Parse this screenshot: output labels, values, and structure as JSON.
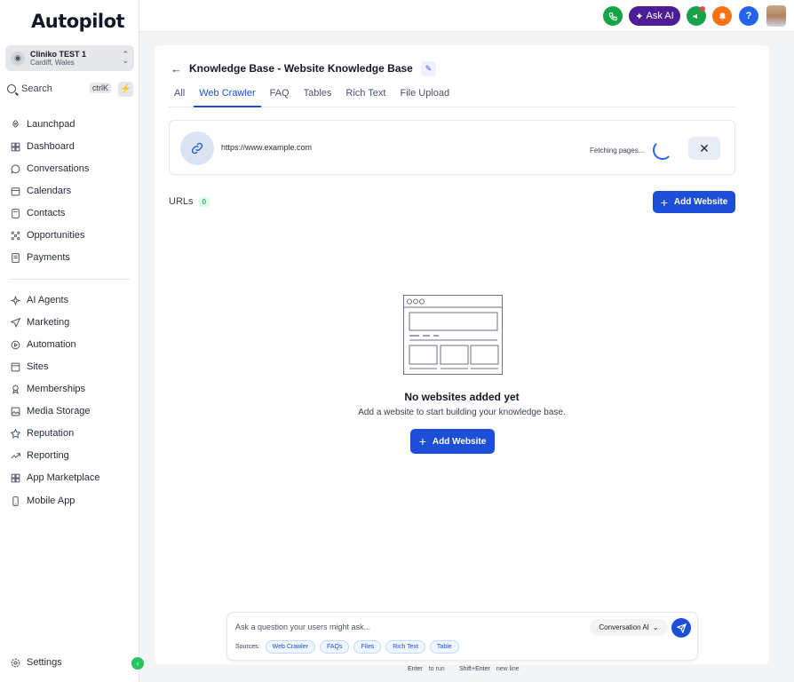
{
  "brand": {
    "logo_text": "Autopilot"
  },
  "account": {
    "name": "Cliniko TEST 1",
    "location": "Cardiff, Wales"
  },
  "search": {
    "label": "Search",
    "shortcut": "ctrlK"
  },
  "nav": [
    {
      "label": "Launchpad",
      "icon": "rocket-icon"
    },
    {
      "label": "Dashboard",
      "icon": "dashboard-icon"
    },
    {
      "label": "Conversations",
      "icon": "chat-icon"
    },
    {
      "label": "Calendars",
      "icon": "calendar-icon"
    },
    {
      "label": "Contacts",
      "icon": "contacts-icon"
    },
    {
      "label": "Opportunities",
      "icon": "opportunities-icon"
    },
    {
      "label": "Payments",
      "icon": "payments-icon"
    },
    {
      "label": "AI Agents",
      "icon": "sparkle-icon"
    },
    {
      "label": "Marketing",
      "icon": "send-icon"
    },
    {
      "label": "Automation",
      "icon": "automation-icon"
    },
    {
      "label": "Sites",
      "icon": "sites-icon"
    },
    {
      "label": "Memberships",
      "icon": "badge-icon"
    },
    {
      "label": "Media Storage",
      "icon": "image-icon"
    },
    {
      "label": "Reputation",
      "icon": "star-icon"
    },
    {
      "label": "Reporting",
      "icon": "trend-icon"
    },
    {
      "label": "App Marketplace",
      "icon": "grid-icon"
    },
    {
      "label": "Mobile App",
      "icon": "mobile-icon"
    }
  ],
  "settings": {
    "label": "Settings"
  },
  "topbar": {
    "ask_ai_label": "Ask AI",
    "help_label": "?"
  },
  "page": {
    "title": "Knowledge Base - Website Knowledge Base",
    "tabs": [
      "All",
      "Web Crawler",
      "FAQ",
      "Tables",
      "Rich Text",
      "File Upload"
    ],
    "active_tab": "Web Crawler"
  },
  "crawler": {
    "url": "https://www.example.com",
    "status": "Fetching pages..."
  },
  "urls": {
    "label": "URLs",
    "count": "0",
    "add_label": "Add Website"
  },
  "empty_state": {
    "title": "No websites added yet",
    "subtitle": "Add a website to start building your knowledge base.",
    "button_label": "Add Website"
  },
  "ask_box": {
    "placeholder": "Ask a question your users might ask...",
    "mode": "Conversation AI",
    "sources_label": "Sources:",
    "sources": [
      "Web Crawler",
      "FAQs",
      "Files",
      "Rich Text",
      "Table"
    ]
  },
  "hints": {
    "run_key": "Enter",
    "run_text": "to run",
    "newline_key": "Shift+Enter",
    "newline_text": "new line"
  },
  "colors": {
    "accent": "#1d4ed8",
    "ask_ai": "#4c1d95",
    "phone": "#16a34a",
    "notification": "#f97316"
  }
}
